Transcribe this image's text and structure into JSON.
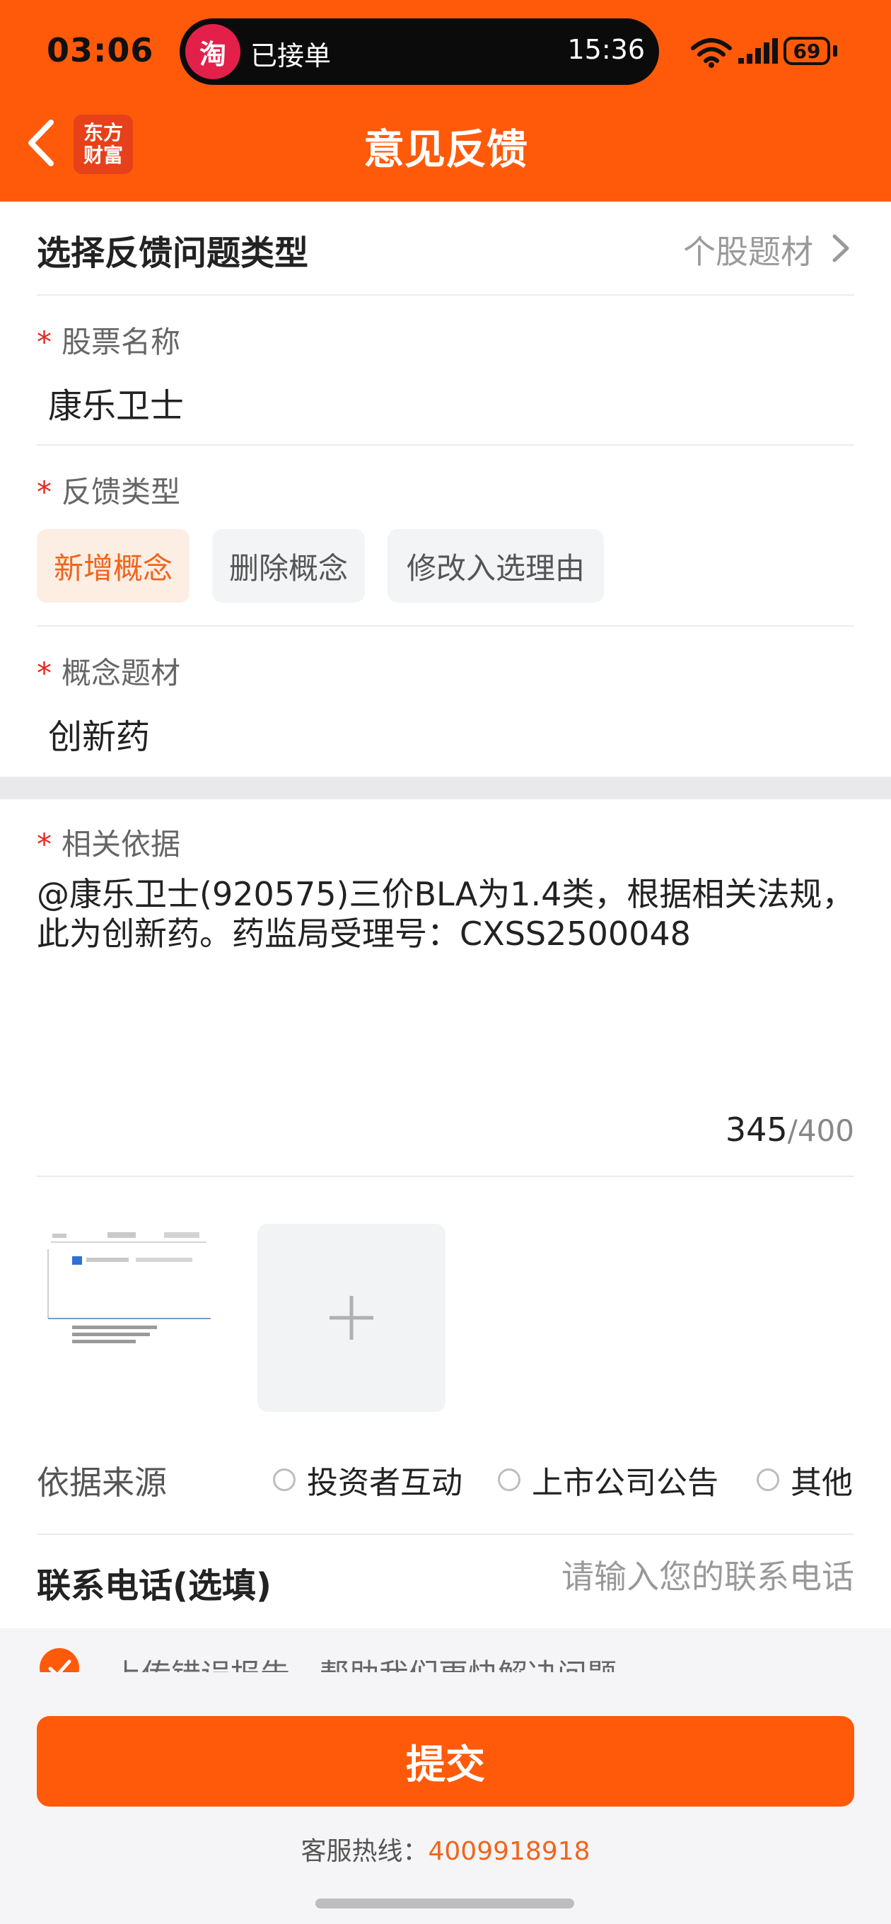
{
  "status_bar": {
    "time": "03:06",
    "island_app_icon_glyph": "淘",
    "island_text": "已接单",
    "island_time": "15:36",
    "battery": "69"
  },
  "header": {
    "title": "意见反馈",
    "logo_line1": "东方",
    "logo_line2": "财富",
    "bg_color": "#ff5a0a"
  },
  "feedback_type_row": {
    "label": "选择反馈问题类型",
    "value": "个股题材"
  },
  "stock_name": {
    "required_mark": "*",
    "label": "股票名称",
    "value": "康乐卫士"
  },
  "feedback_kind": {
    "required_mark": "*",
    "label": "反馈类型",
    "options": [
      "新增概念",
      "删除概念",
      "修改入选理由"
    ],
    "selected": "新增概念"
  },
  "concept": {
    "required_mark": "*",
    "label": "概念题材",
    "value": "创新药"
  },
  "basis": {
    "required_mark": "*",
    "label": "相关依据",
    "text": "@康乐卫士(920575)三价BLA为1.4类，根据相关法规，此为创新药。药监局受理号：CXSS2500048",
    "count": "345",
    "max": "/400"
  },
  "source": {
    "label": "依据来源",
    "options": [
      "投资者互动",
      "上市公司公告",
      "其他"
    ]
  },
  "phone": {
    "label": "联系电话(选填)",
    "placeholder": "请输入您的联系电话"
  },
  "report": {
    "text": "上传错误报告，帮助我们更快解决问题"
  },
  "submit_label": "提交",
  "hotline": {
    "label": "客服热线：",
    "number": "4009918918"
  },
  "colors": {
    "accent": "#ff5a0a",
    "required": "#e7261c",
    "chip_active_text": "#f0651c"
  }
}
